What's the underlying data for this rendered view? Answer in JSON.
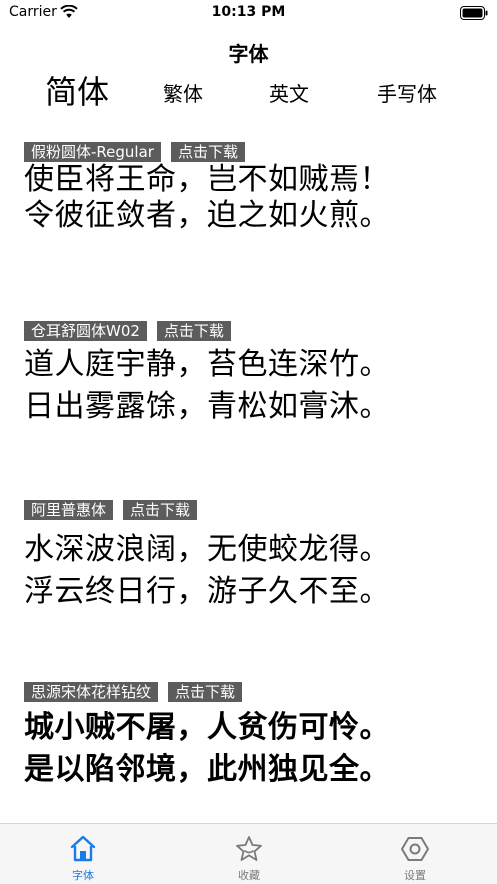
{
  "status_bar": {
    "carrier": "Carrier",
    "time": "10:13 PM"
  },
  "nav": {
    "title": "字体"
  },
  "tabs": [
    {
      "label": "简体",
      "active": true
    },
    {
      "label": "繁体",
      "active": false
    },
    {
      "label": "英文",
      "active": false
    },
    {
      "label": "手写体",
      "active": false
    }
  ],
  "fonts": [
    {
      "name": "假粉圆体-Regular",
      "download": "点击下载",
      "lines": [
        "使臣将王命，岂不如贼焉！",
        "令彼征敛者，迫之如火煎。"
      ]
    },
    {
      "name": "仓耳舒圆体W02",
      "download": "点击下载",
      "lines": [
        "道人庭宇静，苔色连深竹。",
        "日出雾露馀，青松如膏沐。"
      ]
    },
    {
      "name": "阿里普惠体",
      "download": "点击下载",
      "lines": [
        "水深波浪阔，无使蛟龙得。",
        "浮云终日行，游子久不至。"
      ]
    },
    {
      "name": "思源宋体花样钻纹",
      "download": "点击下载",
      "lines": [
        "城小贼不屠，人贫伤可怜。",
        "是以陷邻境，此州独见全。"
      ]
    }
  ],
  "tab_bar": [
    {
      "label": "字体",
      "icon": "home-icon",
      "active": true
    },
    {
      "label": "收藏",
      "icon": "star-icon",
      "active": false
    },
    {
      "label": "设置",
      "icon": "settings-hexagon-icon",
      "active": false
    }
  ],
  "colors": {
    "accent": "#1a7ae6",
    "tag_bg": "#5c5c5c",
    "tab_bar_bg": "#f6f6f6"
  }
}
